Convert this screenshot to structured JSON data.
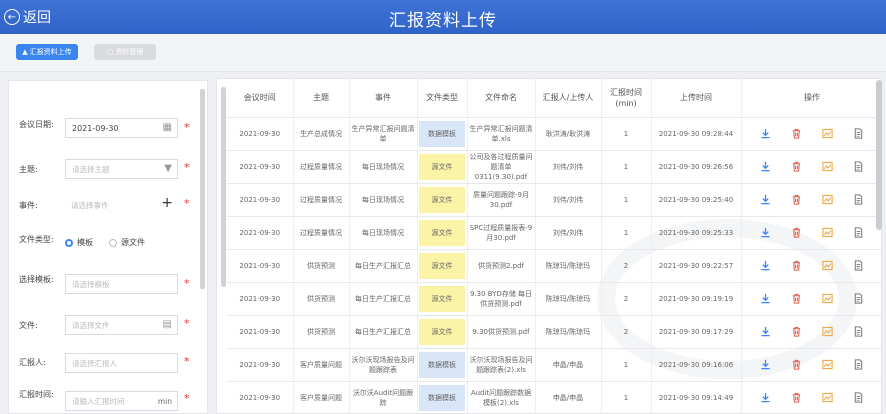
{
  "header": {
    "back_label": "返回",
    "title": "汇报资料上传"
  },
  "tabs": [
    {
      "label": "汇报资料上传"
    },
    {
      "label": "资料管理"
    }
  ],
  "form": {
    "meeting_date": {
      "label": "会议日期:",
      "value": "2021-09-30"
    },
    "subject": {
      "label": "主题:",
      "placeholder": "请选择主题"
    },
    "event": {
      "label": "事件:",
      "placeholder": "请选择事件"
    },
    "file_type": {
      "label": "文件类型:",
      "options": [
        "模板",
        "源文件"
      ],
      "selected": "模板"
    },
    "template": {
      "label": "选择模板:",
      "placeholder": "请选择模板"
    },
    "file": {
      "label": "文件:",
      "placeholder": "请选择文件"
    },
    "reporter": {
      "label": "汇报人:",
      "placeholder": "请选择汇报人"
    },
    "report_time": {
      "label": "汇报时间:",
      "placeholder": "请输入汇报时间",
      "unit": "min"
    }
  },
  "table": {
    "headers": [
      "会议时间",
      "主题",
      "事件",
      "文件类型",
      "文件命名",
      "汇报人/上传人",
      "汇报时间(min)",
      "上传时间",
      "操作"
    ],
    "rows": [
      {
        "date": "2021-09-30",
        "subject": "生产总成情况",
        "event": "生产异常汇报问题清单",
        "type": "数据模板",
        "type_color": "blue",
        "name": "生产异常汇报问题清单.xls",
        "person": "耿洪涛/耿洪涛",
        "minutes": "1",
        "uploaded": "2021-09-30 09:28:44"
      },
      {
        "date": "2021-09-30",
        "subject": "过程质量情况",
        "event": "每日现场情况",
        "type": "源文件",
        "type_color": "yellow",
        "name": "公司及各过程质量问题清单0311(9.30).pdf",
        "person": "刘伟/刘伟",
        "minutes": "1",
        "uploaded": "2021-09-30 09:26:56"
      },
      {
        "date": "2021-09-30",
        "subject": "过程质量情况",
        "event": "每日现场情况",
        "type": "源文件",
        "type_color": "yellow",
        "name": "质量问题跟踪-9月30.pdf",
        "person": "刘伟/刘伟",
        "minutes": "1",
        "uploaded": "2021-09-30 09:25:40"
      },
      {
        "date": "2021-09-30",
        "subject": "过程质量情况",
        "event": "每日现场情况",
        "type": "源文件",
        "type_color": "yellow",
        "name": "SPC过程质量报表-9月30.pdf",
        "person": "刘伟/刘伟",
        "minutes": "1",
        "uploaded": "2021-09-30 09:25:33"
      },
      {
        "date": "2021-09-30",
        "subject": "供货预测",
        "event": "每日生产汇报汇总",
        "type": "源文件",
        "type_color": "yellow",
        "name": "供货预测2.pdf",
        "person": "陈琼玛/陈琼玛",
        "minutes": "2",
        "uploaded": "2021-09-30 09:22:57"
      },
      {
        "date": "2021-09-30",
        "subject": "供货预测",
        "event": "每日生产汇报汇总",
        "type": "源文件",
        "type_color": "yellow",
        "name": "9.30 BYD存储 每日供货预测.pdf",
        "person": "陈琼玛/陈琼玛",
        "minutes": "2",
        "uploaded": "2021-09-30 09:19:19"
      },
      {
        "date": "2021-09-30",
        "subject": "供货预测",
        "event": "每日生产汇报汇总",
        "type": "源文件",
        "type_color": "yellow",
        "name": "9.30供货预测.pdf",
        "person": "陈琼玛/陈琼玛",
        "minutes": "2",
        "uploaded": "2021-09-30 09:17:29"
      },
      {
        "date": "2021-09-30",
        "subject": "客户质量问题",
        "event": "沃尔沃现场报告及问题跟踪表",
        "type": "数据模板",
        "type_color": "blue",
        "name": "沃尔沃现场报告及问题跟踪表(2).xls",
        "person": "申晶/申晶",
        "minutes": "1",
        "uploaded": "2021-09-30 09:16:06"
      },
      {
        "date": "2021-09-30",
        "subject": "客户质量问题",
        "event": "沃尔沃Audit问题跟踪",
        "type": "数据模板",
        "type_color": "blue",
        "name": "Audit问题跟踪数据模板(2).xls",
        "person": "申晶/申晶",
        "minutes": "1",
        "uploaded": "2021-09-30 09:14:49"
      }
    ]
  },
  "colors": {
    "header_blue": "#3166cc",
    "accent_blue": "#3a86f0",
    "required_red": "#e0342c",
    "tag_blue": "#d9e6f7",
    "tag_yellow": "#fbf3a6",
    "op_blue": "#3a86f0",
    "op_red": "#e05a4a",
    "op_orange": "#f0a030",
    "op_gray": "#777777"
  },
  "icons": {
    "back": "arrow-left-circle-icon",
    "calendar": "calendar-icon",
    "dropdown": "filter-icon",
    "add": "plus-icon",
    "file": "file-icon",
    "download": "download-icon",
    "delete": "trash-icon",
    "chart": "chart-icon",
    "view": "document-icon"
  }
}
